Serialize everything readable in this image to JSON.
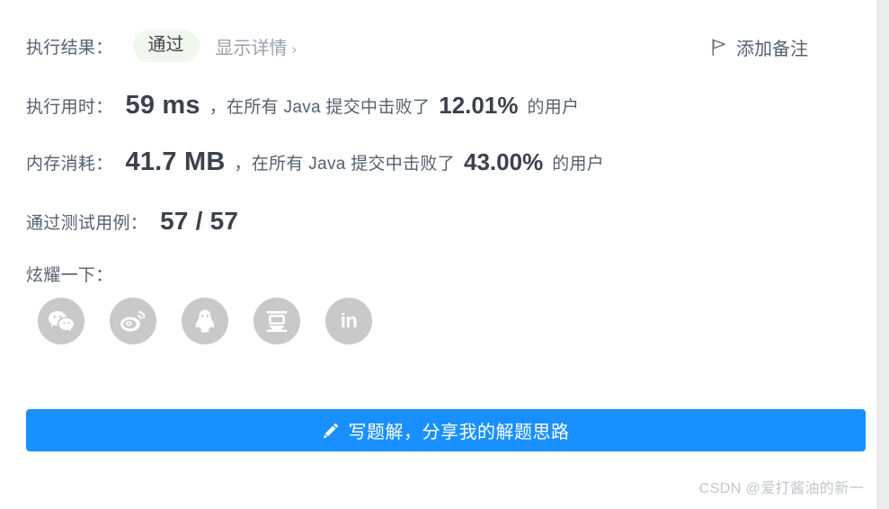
{
  "result": {
    "label": "执行结果：",
    "status": "通过",
    "detail_link": "显示详情",
    "chevron": "›"
  },
  "add_note": {
    "label": "添加备注",
    "icon": "flag-icon"
  },
  "runtime": {
    "label": "执行用时：",
    "value": "59 ms",
    "middle_text": "，在所有 Java 提交中击败了",
    "percent": "12.01%",
    "suffix": "的用户"
  },
  "memory": {
    "label": "内存消耗：",
    "value": "41.7 MB",
    "middle_text": "，在所有 Java 提交中击败了",
    "percent": "43.00%",
    "suffix": "的用户"
  },
  "testcases": {
    "label": "通过测试用例：",
    "value": "57 / 57"
  },
  "share": {
    "label": "炫耀一下：",
    "items": [
      {
        "name": "wechat-icon",
        "title": "微信"
      },
      {
        "name": "weibo-icon",
        "title": "微博"
      },
      {
        "name": "qq-icon",
        "title": "QQ"
      },
      {
        "name": "douban-icon",
        "title": "豆瓣"
      },
      {
        "name": "linkedin-icon",
        "title": "LinkedIn",
        "text": "in"
      }
    ]
  },
  "primary_button": {
    "label": "写题解，分享我的解题思路",
    "icon": "pencil-icon"
  },
  "watermark": {
    "text": "CSDN @爱打酱油的新一"
  },
  "colors": {
    "accent": "#1890ff",
    "status_bg": "#f0f7ec",
    "text": "#55606e",
    "metric": "#3c424c",
    "muted": "#9aa2ad",
    "share_circle": "#c9c9c9",
    "gutter": "#ececec"
  }
}
